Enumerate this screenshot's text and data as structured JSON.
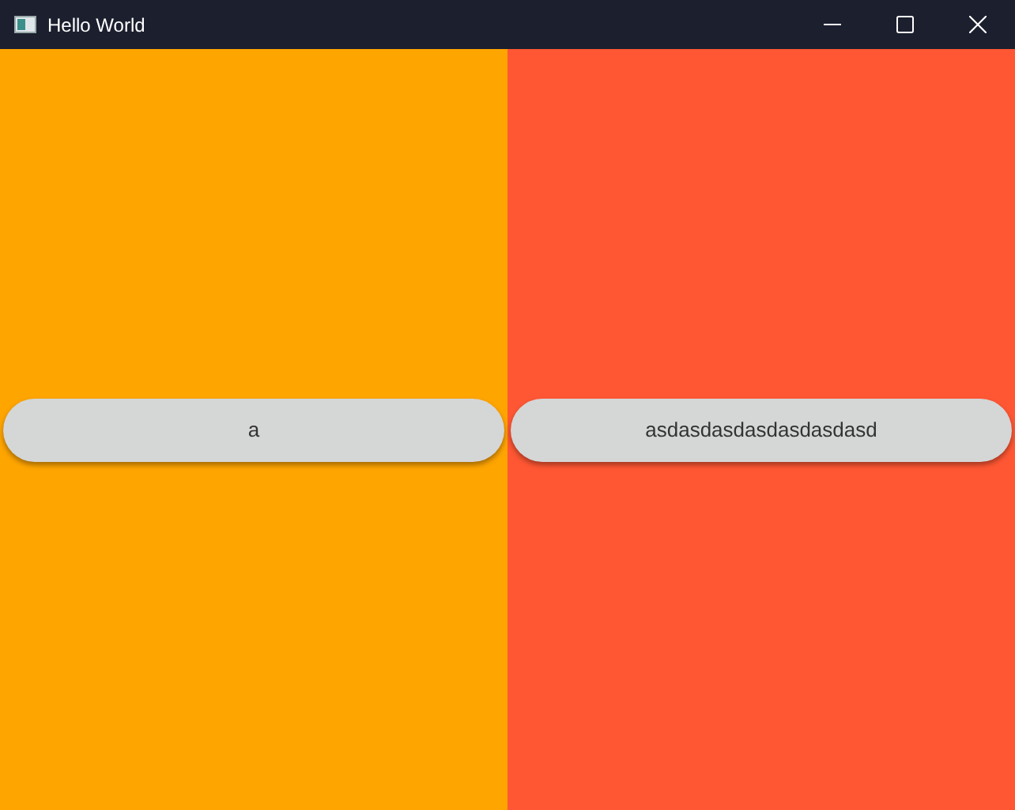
{
  "window": {
    "title": "Hello World"
  },
  "panels": [
    {
      "color": "#ffa500",
      "button": "a"
    },
    {
      "color": "#ff5733",
      "button": "asdasdasdasdasdasdasd"
    }
  ]
}
